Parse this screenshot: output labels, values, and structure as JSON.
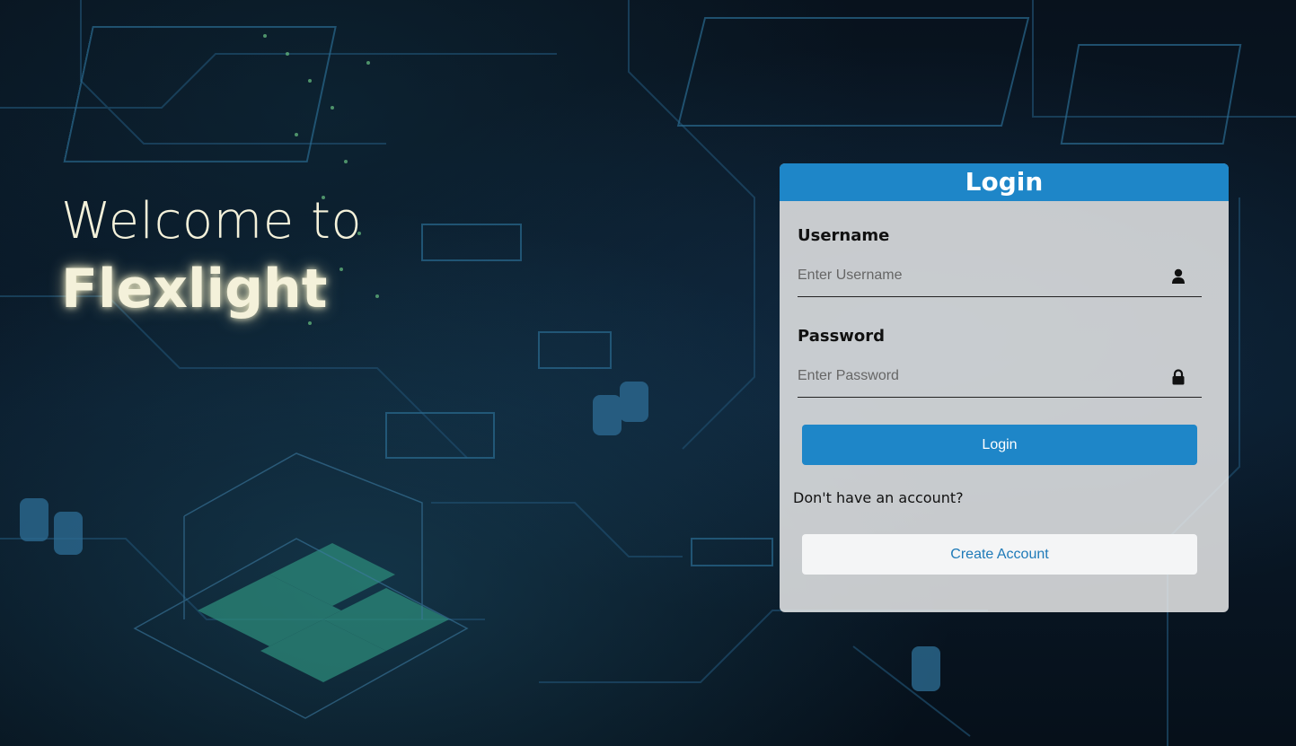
{
  "hero": {
    "welcome_text": "Welcome to",
    "brand_name": "Flexlight"
  },
  "login_card": {
    "title": "Login",
    "username": {
      "label": "Username",
      "placeholder": "Enter Username",
      "icon": "user-icon"
    },
    "password": {
      "label": "Password",
      "placeholder": "Enter Password",
      "icon": "lock-icon"
    },
    "login_button": "Login",
    "no_account_text": "Don't have an account?",
    "create_account_button": "Create Account"
  },
  "colors": {
    "accent": "#1e86c8",
    "hero_text": "#f4f1da",
    "background": "#06111d"
  }
}
